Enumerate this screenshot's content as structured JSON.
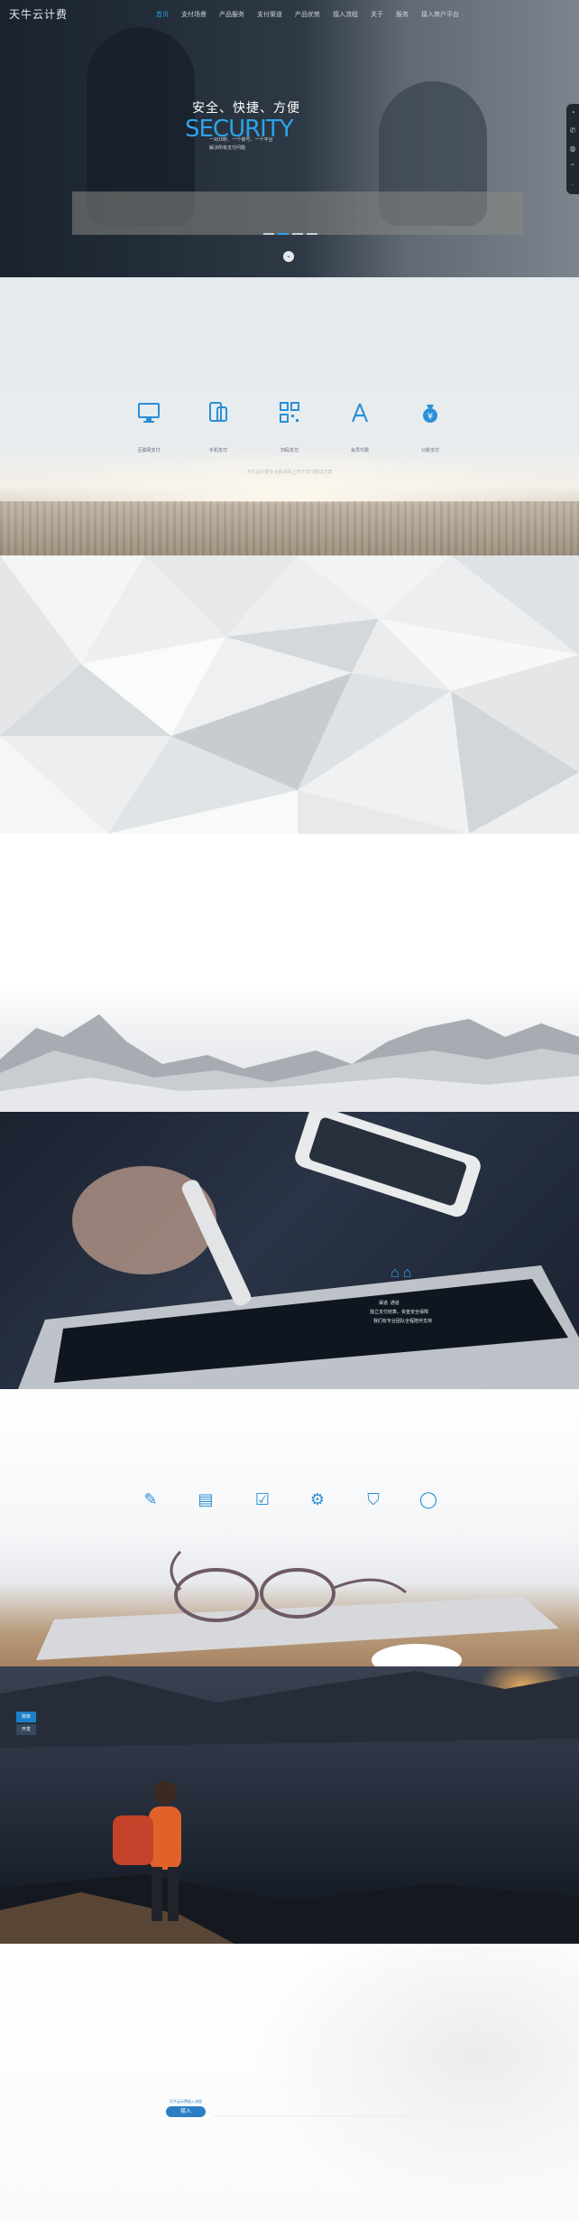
{
  "header": {
    "logo": "天牛云计费",
    "nav": [
      "首页",
      "支付场景",
      "产品服务",
      "支付渠道",
      "产品优势",
      "接入流程",
      "关于",
      "服务",
      "接入商户平台"
    ],
    "active_index": 0
  },
  "hero": {
    "slogan": "安全、快捷、方便",
    "headline": "SECURITY",
    "sub1": "一对10秒、一个账号、一个平台",
    "sub2": "解决所有支付问题",
    "down_icon": "chevron-down-icon"
  },
  "sidebar_icons": [
    "qq-icon",
    "phone-icon",
    "wechat-icon",
    "top-icon"
  ],
  "services": {
    "items": [
      {
        "label": "互联网支付",
        "icon": "monitor-icon"
      },
      {
        "label": "手机支付",
        "icon": "mobile-icon"
      },
      {
        "label": "扫码支付",
        "icon": "qrcode-icon"
      },
      {
        "label": "会员付费",
        "icon": "app-store-icon"
      },
      {
        "label": "公账支付",
        "icon": "coin-bag-icon"
      }
    ],
    "tagline": "天牛云计费专业解决线上线下支付整体方案"
  },
  "tablet": {
    "tab_a": "渠道",
    "tab_b": "通道",
    "line1": "独立支付结算，资金安全保障",
    "line2": "我们有专业团队全程陪伴支持"
  },
  "advantage_icons": [
    "pen-icon",
    "id-card-icon",
    "checklist-icon",
    "gear-icon",
    "shield-icon",
    "chat-icon"
  ],
  "hiker": {
    "tab1": "简单",
    "tab2": "开发"
  },
  "footer_badge": {
    "top": "天牛云计费接入流程",
    "body": "接入"
  },
  "colors": {
    "accent": "#2a8fd6",
    "nav_active": "#2a9ee0"
  }
}
